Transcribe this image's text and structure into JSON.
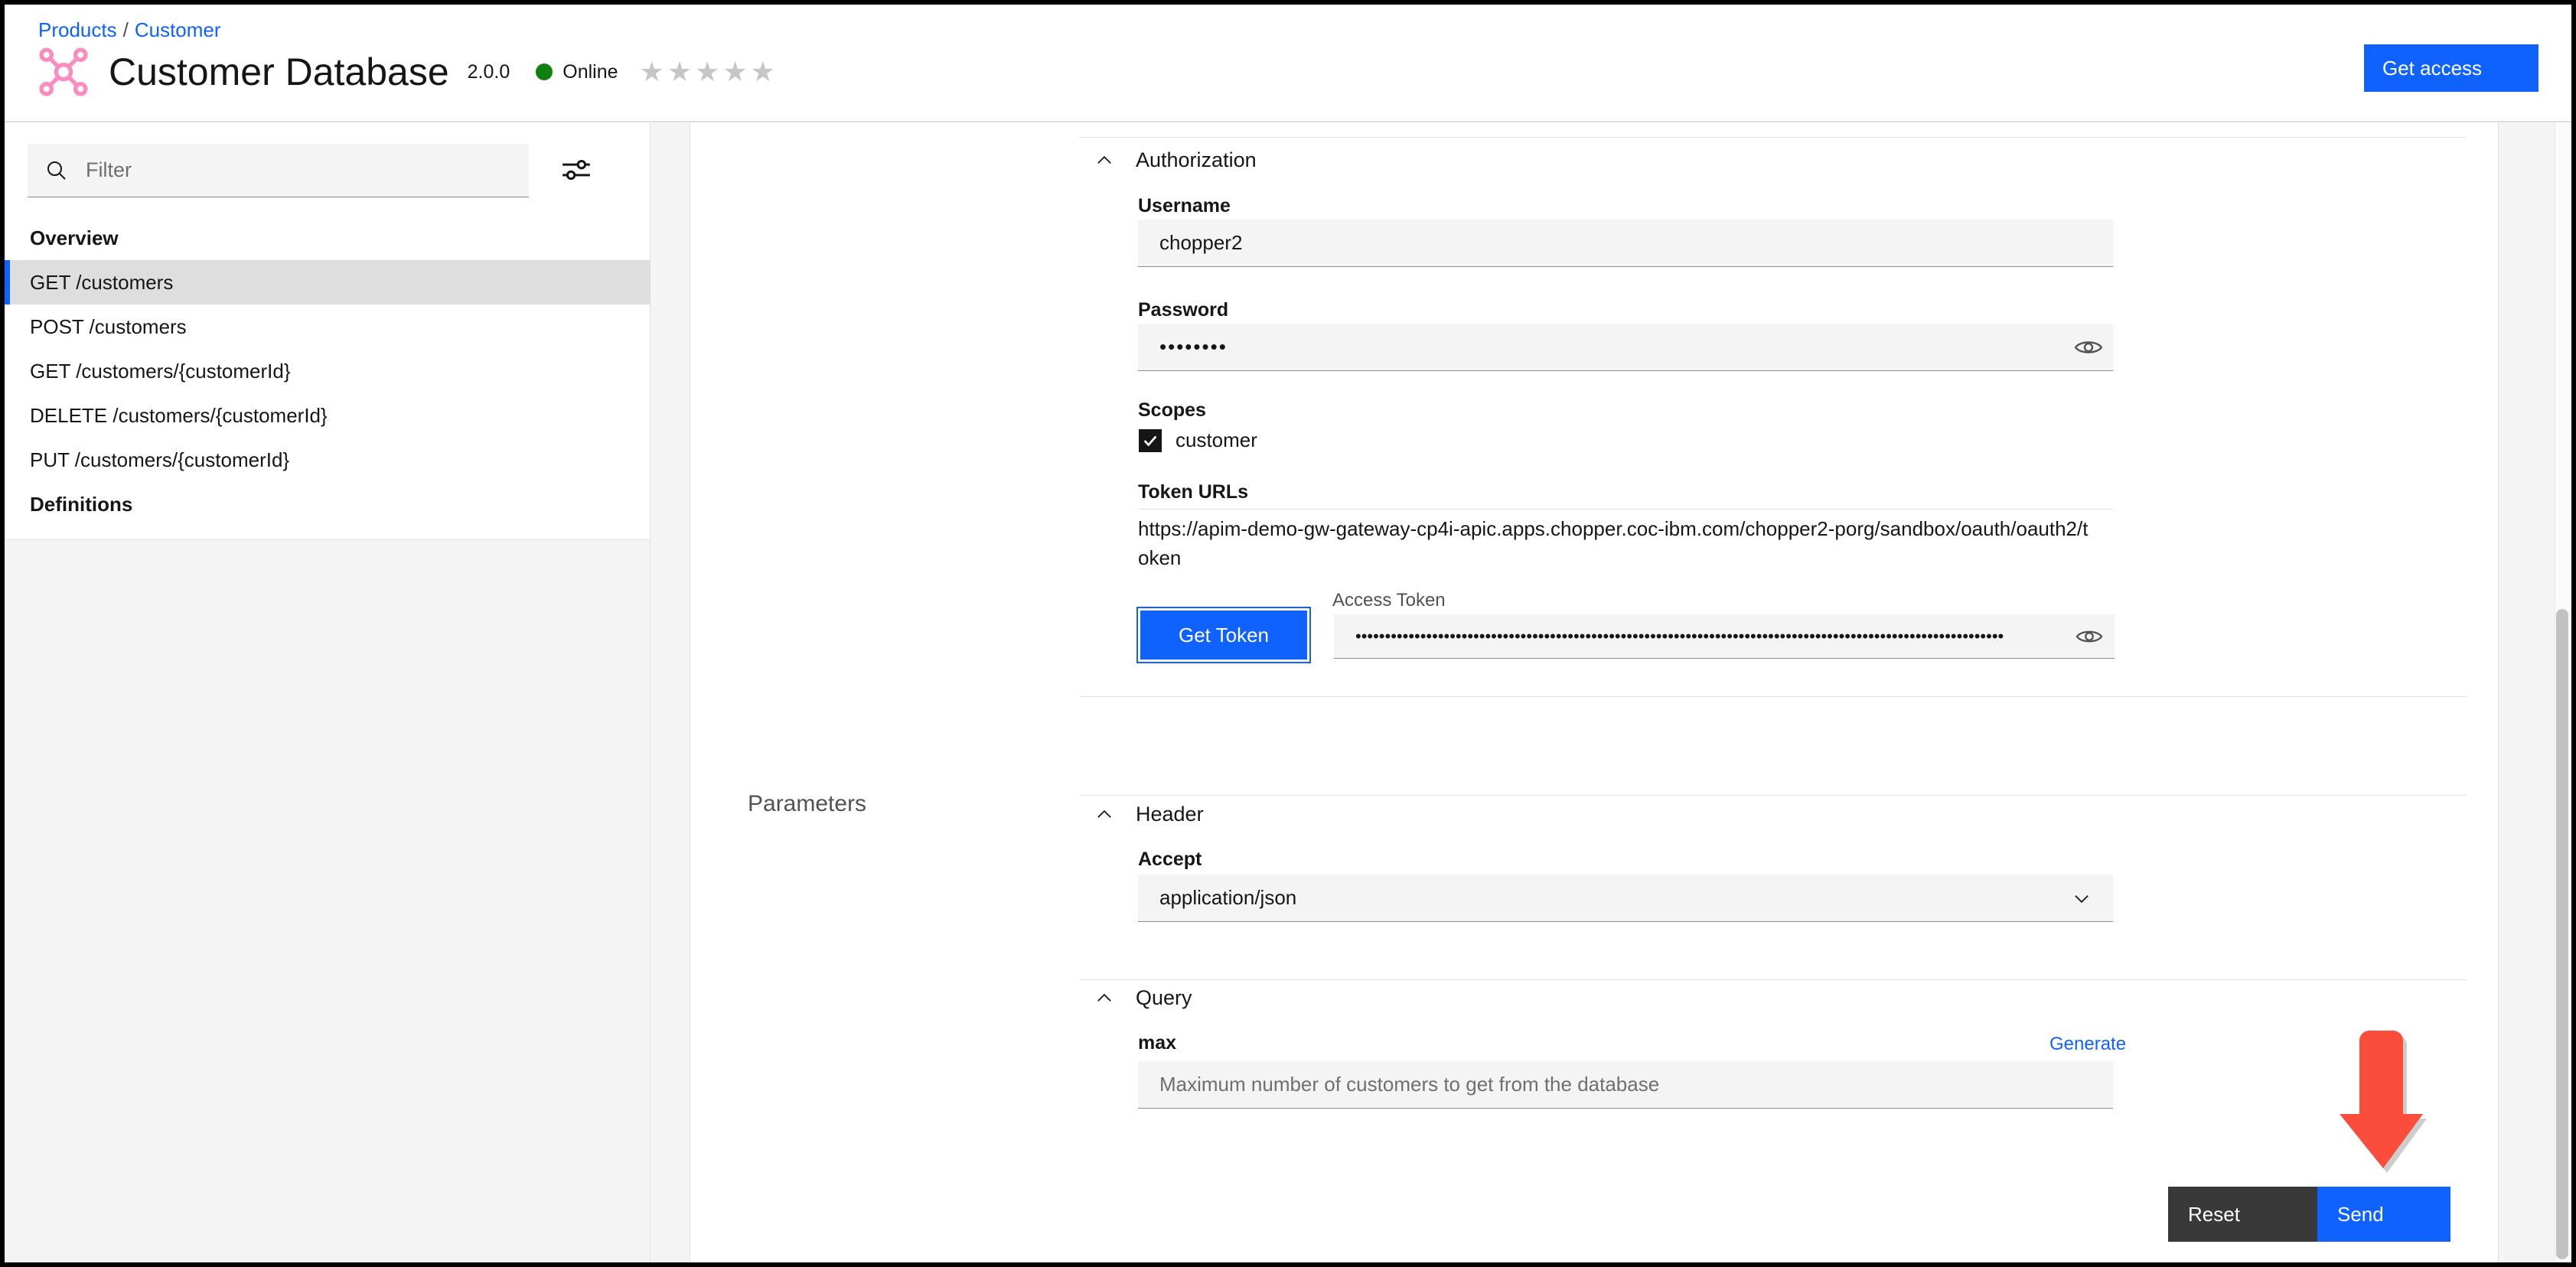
{
  "header": {
    "breadcrumb": {
      "products": "Products",
      "separator": "/",
      "customer": "Customer"
    },
    "logo_icon": "node-graph-icon",
    "title": "Customer Database",
    "version": "2.0.0",
    "status": {
      "label": "Online",
      "color": "#108010"
    },
    "rating": {
      "stars": 5,
      "filled": 0,
      "color": "#c6c6c6"
    },
    "get_access_label": "Get access",
    "accent_color": "#0f62fe"
  },
  "sidebar": {
    "filter_placeholder": "Filter",
    "filter_value": "",
    "search_icon": "search-icon",
    "settings_icon": "sliders-icon",
    "items": [
      {
        "label": "Overview",
        "type": "heading",
        "selected": false
      },
      {
        "label": "GET /customers",
        "type": "operation",
        "selected": true
      },
      {
        "label": "POST /customers",
        "type": "operation",
        "selected": false
      },
      {
        "label": "GET /customers/{customerId}",
        "type": "operation",
        "selected": false
      },
      {
        "label": "DELETE /customers/{customerId}",
        "type": "operation",
        "selected": false
      },
      {
        "label": "PUT /customers/{customerId}",
        "type": "operation",
        "selected": false
      },
      {
        "label": "Definitions",
        "type": "heading",
        "selected": false
      }
    ]
  },
  "main": {
    "authorization": {
      "section_label": "Authorization",
      "expanded": true,
      "username": {
        "label": "Username",
        "value": "chopper2"
      },
      "password": {
        "label": "Password",
        "value": "••••••••",
        "reveal_icon": "eye-icon"
      },
      "scopes": {
        "label": "Scopes",
        "items": [
          {
            "label": "customer",
            "checked": true
          }
        ]
      },
      "token_urls": {
        "label": "Token URLs",
        "url": "https://apim-demo-gw-gateway-cp4i-apic.apps.chopper.coc-ibm.com/chopper2-porg/sandbox/oauth/oauth2/token"
      },
      "get_token_label": "Get Token",
      "access_token": {
        "label": "Access Token",
        "value": "••••••••••••••••••••••••••••••••••••••••••••••••••••••••••••••••••••••••••••••••••••••••••••••••••••••••••••••",
        "reveal_icon": "eye-icon"
      }
    },
    "parameters": {
      "label": "Parameters",
      "header_group": {
        "section_label": "Header",
        "expanded": true,
        "accept": {
          "label": "Accept",
          "value": "application/json",
          "chevron_icon": "chevron-down-icon"
        }
      },
      "query_group": {
        "section_label": "Query",
        "expanded": true,
        "max": {
          "label": "max",
          "generate_label": "Generate",
          "placeholder": "Maximum number of customers to get from the database",
          "value": ""
        }
      }
    },
    "actions": {
      "reset_label": "Reset",
      "send_label": "Send"
    }
  },
  "annotation": {
    "arrow": {
      "direction": "down",
      "color": "#fa4d3c",
      "points_to": "send-button"
    }
  }
}
